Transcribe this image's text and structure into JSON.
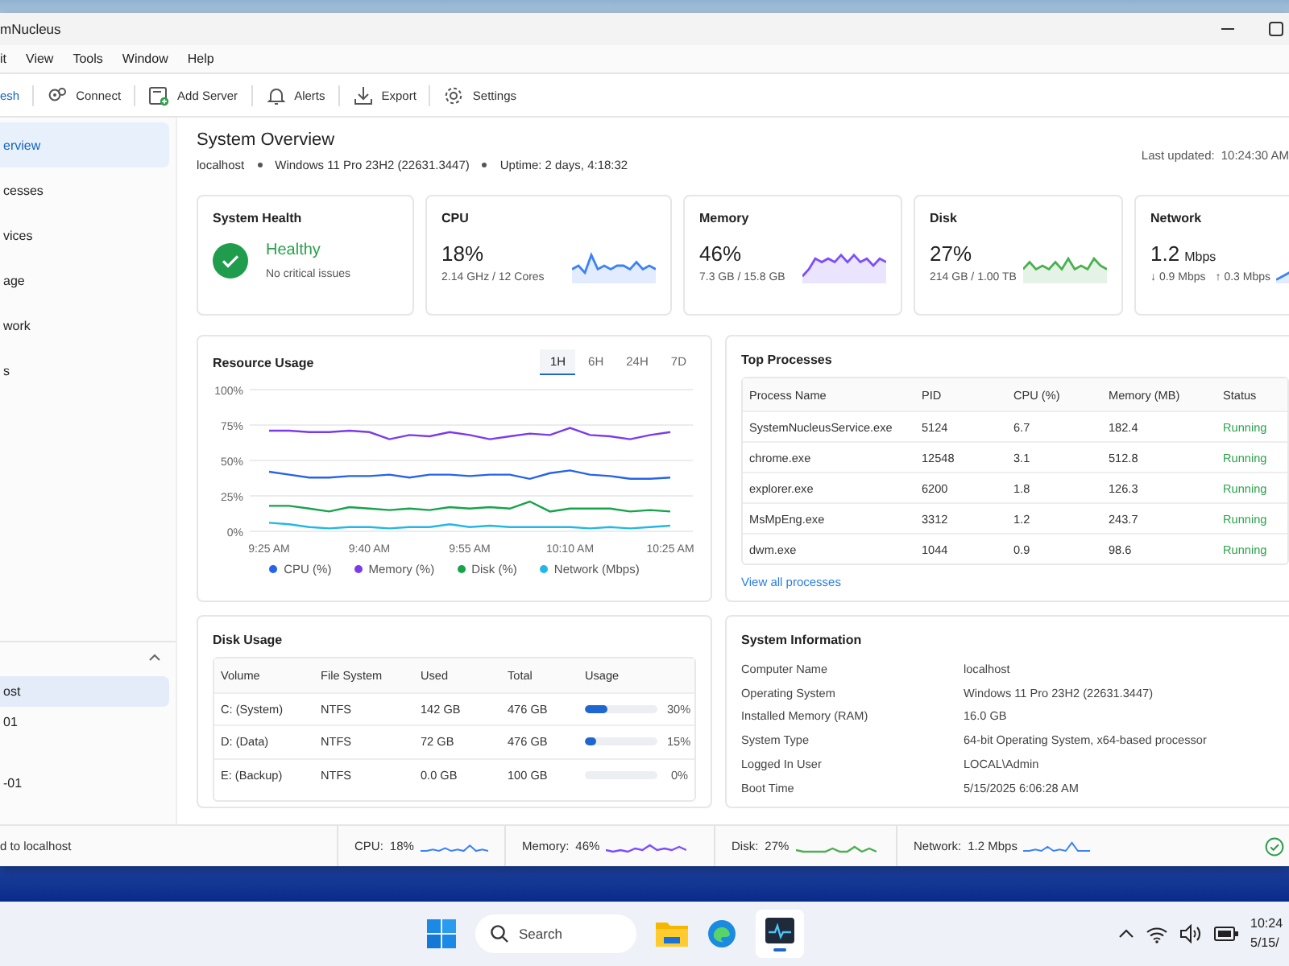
{
  "window": {
    "title": "mNucleus"
  },
  "menu": [
    "it",
    "View",
    "Tools",
    "Window",
    "Help"
  ],
  "toolbar": [
    {
      "kind": "refresh",
      "label": "esh"
    },
    {
      "kind": "connect",
      "label": "Connect"
    },
    {
      "kind": "add",
      "label": "Add Server"
    },
    {
      "kind": "alerts",
      "label": "Alerts"
    },
    {
      "kind": "export",
      "label": "Export"
    },
    {
      "kind": "settings",
      "label": "Settings"
    }
  ],
  "sidebar": {
    "items": [
      {
        "label": "erview",
        "selected": true
      },
      {
        "label": "cesses",
        "selected": false
      },
      {
        "label": "vices",
        "selected": false
      },
      {
        "label": "age",
        "selected": false
      },
      {
        "label": "work",
        "selected": false
      },
      {
        "label": "s",
        "selected": false
      }
    ],
    "servers": {
      "expanded": true,
      "items": [
        {
          "label": "ost",
          "selected": true
        },
        {
          "label": "01",
          "selected": false
        },
        {
          "label": "-01",
          "selected": false
        }
      ]
    }
  },
  "header": {
    "title": "System Overview",
    "host": "localhost",
    "os": "Windows 11 Pro 23H2 (22631.3447)",
    "uptime": "Uptime: 2 days, 4:18:32",
    "updated_label": "Last updated:",
    "updated": "10:24:30 AM"
  },
  "health": {
    "title": "System Health",
    "status": "Healthy",
    "detail": "No critical issues"
  },
  "metrics": [
    {
      "kind": "cpu",
      "title": "CPU",
      "value": "18%",
      "detail": "2.14 GHz / 12 Cores",
      "color": "#3b82f6"
    },
    {
      "kind": "memory",
      "title": "Memory",
      "value": "46%",
      "detail": "7.3 GB / 15.8 GB",
      "color": "#7c4dff"
    },
    {
      "kind": "disk",
      "title": "Disk",
      "value": "27%",
      "detail": "214 GB / 1.00 TB",
      "color": "#4caf50"
    },
    {
      "kind": "network",
      "title": "Network",
      "value": "1.2",
      "unit": "Mbps",
      "down": "↓ 0.9 Mbps",
      "up": "↑ 0.3 Mbps",
      "color": "#3b82f6"
    }
  ],
  "resource_usage": {
    "title": "Resource Usage",
    "ranges": [
      {
        "label": "1H",
        "selected": true
      },
      {
        "label": "6H",
        "selected": false
      },
      {
        "label": "24H",
        "selected": false
      },
      {
        "label": "7D",
        "selected": false
      }
    ],
    "chart_data": {
      "type": "line",
      "categories": [
        "9:25 AM",
        null,
        null,
        null,
        null,
        "9:40 AM",
        null,
        null,
        null,
        null,
        "9:55 AM",
        null,
        null,
        null,
        null,
        "10:10 AM",
        null,
        null,
        null,
        null,
        "10:25 AM"
      ],
      "ylim": [
        0,
        100
      ],
      "grid": true,
      "yticks": [
        {
          "value": 0,
          "label": "0%"
        },
        {
          "value": 25,
          "label": "25%"
        },
        {
          "value": 50,
          "label": "50%"
        },
        {
          "value": 75,
          "label": "75%"
        },
        {
          "value": 100,
          "label": "100%"
        }
      ],
      "series": [
        {
          "name": "CPU (%)",
          "color": "#2563eb",
          "values": [
            42,
            40,
            38,
            38,
            39,
            39,
            40,
            38,
            40,
            40,
            39,
            40,
            40,
            37,
            41,
            43,
            40,
            39,
            37,
            37,
            38
          ]
        },
        {
          "name": "Memory (%)",
          "color": "#7c3aed",
          "values": [
            71,
            71,
            70,
            70,
            71,
            70,
            65,
            68,
            67,
            70,
            68,
            65,
            67,
            69,
            68,
            73,
            68,
            67,
            65,
            68,
            70
          ]
        },
        {
          "name": "Disk (%)",
          "color": "#16a34a",
          "values": [
            18,
            18,
            16,
            14,
            17,
            16,
            15,
            16,
            15,
            17,
            16,
            17,
            16,
            21,
            14,
            16,
            16,
            16,
            14,
            15,
            14
          ]
        },
        {
          "name": "Network (Mbps)",
          "color": "#22b8e6",
          "values": [
            6,
            5,
            3,
            2,
            3,
            3,
            2,
            3,
            3,
            5,
            3,
            4,
            3,
            3,
            3,
            3,
            2,
            3,
            2,
            3,
            4
          ]
        }
      ]
    }
  },
  "top_processes": {
    "title": "Top Processes",
    "columns": [
      "Process Name",
      "PID",
      "CPU (%)",
      "Memory (MB)",
      "Status"
    ],
    "rows": [
      [
        "SystemNucleusService.exe",
        "5124",
        "6.7",
        "182.4",
        "Running"
      ],
      [
        "chrome.exe",
        "12548",
        "3.1",
        "512.8",
        "Running"
      ],
      [
        "explorer.exe",
        "6200",
        "1.8",
        "126.3",
        "Running"
      ],
      [
        "MsMpEng.exe",
        "3312",
        "1.2",
        "243.7",
        "Running"
      ],
      [
        "dwm.exe",
        "1044",
        "0.9",
        "98.6",
        "Running"
      ]
    ],
    "link": "View all processes"
  },
  "disk_usage": {
    "title": "Disk Usage",
    "columns": [
      "Volume",
      "File System",
      "Used",
      "Total",
      "Usage"
    ],
    "rows": [
      {
        "volume": "C: (System)",
        "fs": "NTFS",
        "used": "142 GB",
        "total": "476 GB",
        "level": 0.3,
        "reading": "30%"
      },
      {
        "volume": "D: (Data)",
        "fs": "NTFS",
        "used": "72 GB",
        "total": "476 GB",
        "level": 0.15,
        "reading": "15%"
      },
      {
        "volume": "E: (Backup)",
        "fs": "NTFS",
        "used": "0.0 GB",
        "total": "100 GB",
        "level": 0,
        "reading": "0%"
      }
    ]
  },
  "system_info": {
    "title": "System Information",
    "rows": [
      [
        "Computer Name",
        "localhost"
      ],
      [
        "Operating System",
        "Windows 11 Pro 23H2 (22631.3447)"
      ],
      [
        "Installed Memory (RAM)",
        "16.0 GB"
      ],
      [
        "System Type",
        "64-bit Operating System, x64-based processor"
      ],
      [
        "Logged In User",
        "LOCAL\\Admin"
      ],
      [
        "Boot Time",
        "5/15/2025 6:06:28 AM"
      ]
    ]
  },
  "status_bar": {
    "connection": "d to localhost",
    "items": [
      {
        "label": "CPU:",
        "value": "18%",
        "color": "#3b82f6"
      },
      {
        "label": "Memory:",
        "value": "46%",
        "color": "#7c4dff"
      },
      {
        "label": "Disk:",
        "value": "27%",
        "color": "#4caf50"
      },
      {
        "label": "Network:",
        "value": "1.2 Mbps",
        "color": "#3b82f6"
      }
    ]
  },
  "taskbar": {
    "search_placeholder": "Search",
    "time": "10:24",
    "date": "5/15/"
  }
}
